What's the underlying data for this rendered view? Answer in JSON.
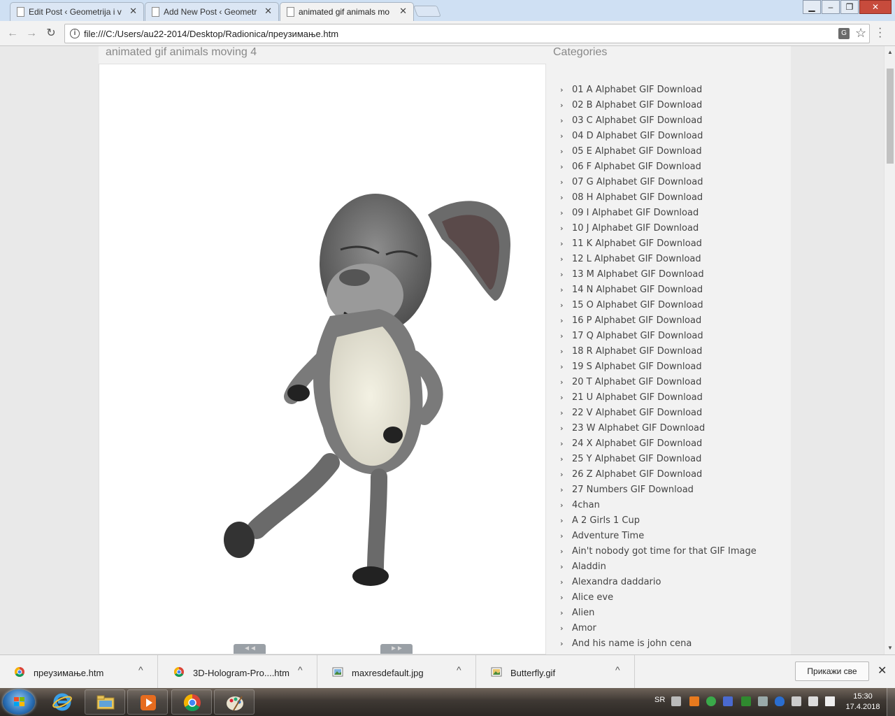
{
  "tabs": [
    {
      "title": "Edit Post ‹ Geometrija i v"
    },
    {
      "title": "Add New Post ‹ Geometr"
    },
    {
      "title": "animated gif animals mo"
    }
  ],
  "toolbar": {
    "url": "file:///C:/Users/au22-2014/Desktop/Radionica/преузимање.htm"
  },
  "page": {
    "post_title": "animated gif animals moving 4",
    "sidebar_title": "Categories",
    "categories": [
      "01 A Alphabet GIF Download",
      "02 B Alphabet GIF Download",
      "03 C Alphabet GIF Download",
      "04 D Alphabet GIF Download",
      "05 E Alphabet GIF Download",
      "06 F Alphabet GIF Download",
      "07 G Alphabet GIF Download",
      "08 H Alphabet GIF Download",
      "09 I Alphabet GIF Download",
      "10 J Alphabet GIF Download",
      "11 K Alphabet GIF Download",
      "12 L Alphabet GIF Download",
      "13 M Alphabet GIF Download",
      "14 N Alphabet GIF Download",
      "15 O Alphabet GIF Download",
      "16 P Alphabet GIF Download",
      "17 Q Alphabet GIF Download",
      "18 R Alphabet GIF Download",
      "19 S Alphabet GIF Download",
      "20 T Alphabet GIF Download",
      "21 U Alphabet GIF Download",
      "22 V Alphabet GIF Download",
      "23 W Alphabet GIF Download",
      "24 X Alphabet GIF Download",
      "25 Y Alphabet GIF Download",
      "26 Z Alphabet GIF Download",
      "27 Numbers GIF Download",
      "4chan",
      "A 2 Girls 1 Cup",
      "Adventure Time",
      "Ain't nobody got time for that GIF Image",
      "Aladdin",
      "Alexandra daddario",
      "Alice eve",
      "Alien",
      "Amor",
      "And his name is john cena"
    ]
  },
  "downloads": {
    "items": [
      {
        "name": "преузимање.htm",
        "icon": "chrome-icon"
      },
      {
        "name": "3D-Hologram-Pro....htm",
        "icon": "chrome-icon"
      },
      {
        "name": "maxresdefault.jpg",
        "icon": "image-file-icon"
      },
      {
        "name": "Butterfly.gif",
        "icon": "image-file-icon"
      }
    ],
    "show_all": "Прикажи све"
  },
  "taskbar": {
    "lang": "SR",
    "time": "15:30",
    "date": "17.4.2018"
  }
}
